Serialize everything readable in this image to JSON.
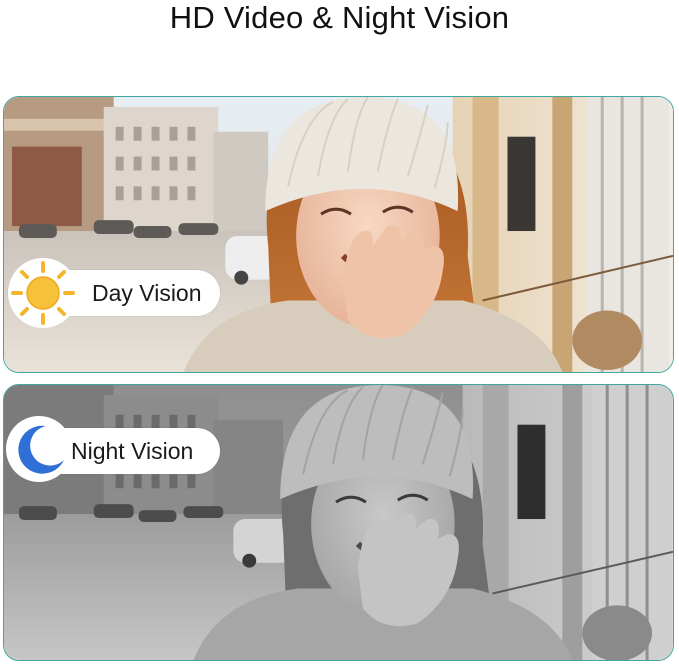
{
  "header": {
    "title": "HD Video & Night Vision"
  },
  "panels": {
    "day": {
      "label": "Day Vision",
      "icon": "sun-icon",
      "icon_color": "#f5b82e"
    },
    "night": {
      "label": "Night Vision",
      "icon": "crescent-moon-icon",
      "icon_color": "#2f6fd6"
    }
  },
  "colors": {
    "panel_border": "#3fa7a0"
  }
}
